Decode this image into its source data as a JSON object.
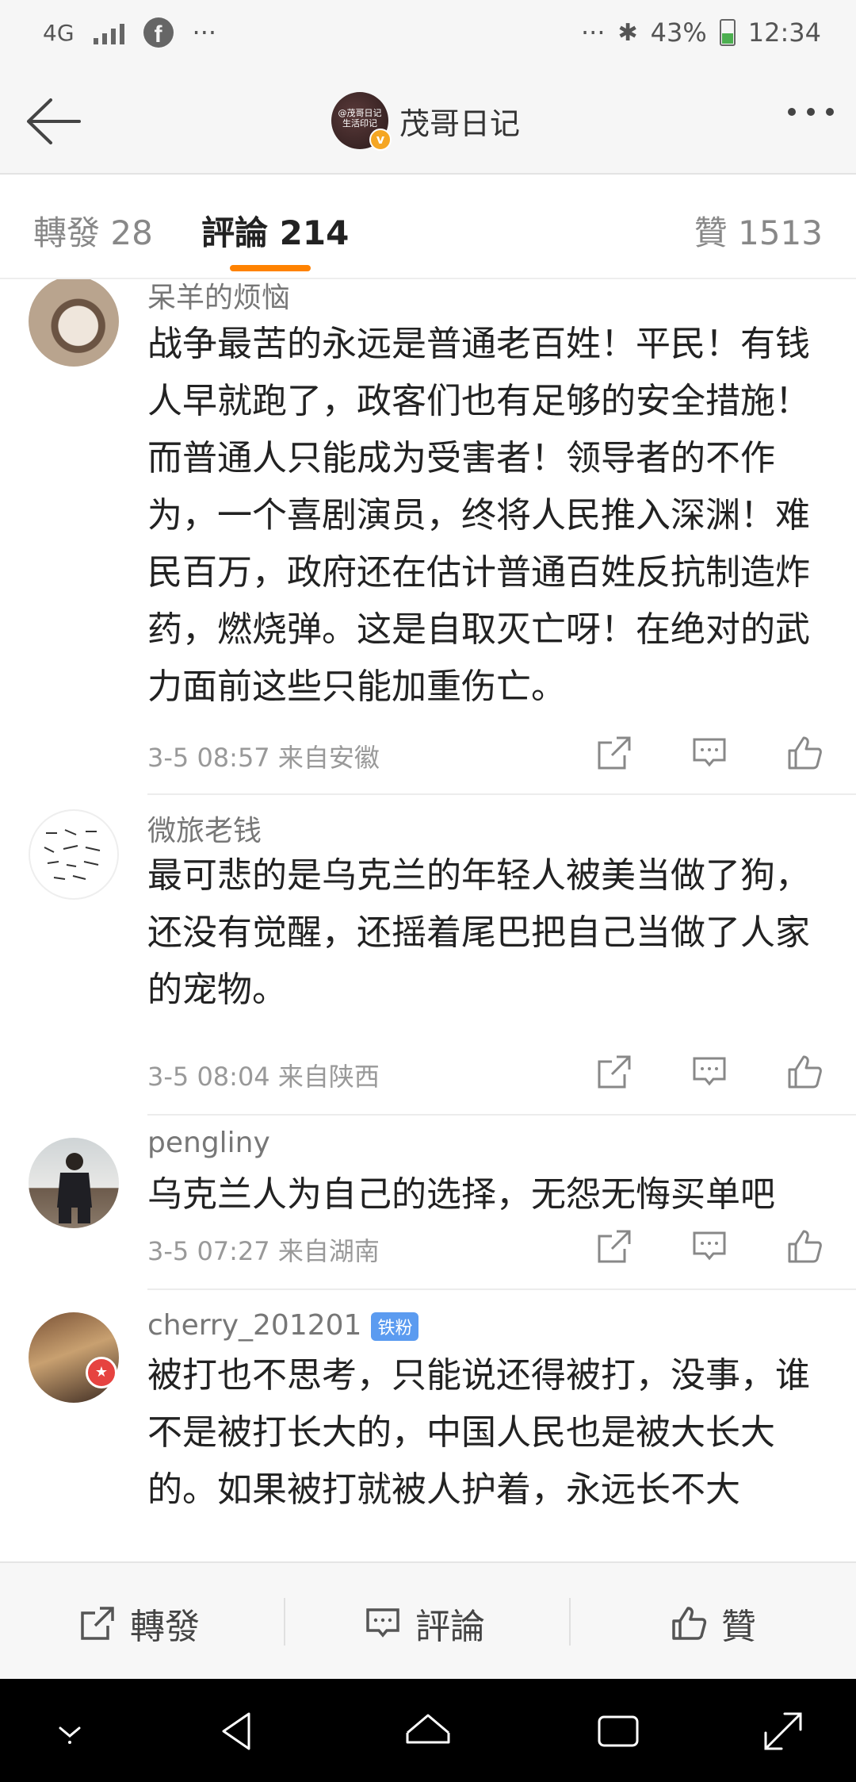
{
  "status_bar": {
    "network": "4G",
    "more": "···",
    "right_more": "···",
    "battery": "43%",
    "time": "12:34"
  },
  "header": {
    "account_name": "茂哥日记",
    "avatar_text": "@茂哥日记 生活印记"
  },
  "tabs": [
    {
      "label": "轉發 28"
    },
    {
      "label": "評論 214"
    },
    {
      "label": "贊 1513"
    }
  ],
  "comments": [
    {
      "username": "呆羊的烦恼",
      "lines": [
        "战争最苦的永远是普通老百姓！平民！有钱",
        "人早就跑了，政客们也有足够的安全措施！",
        "而普通人只能成为受害者！领导者的不作",
        "为，一个喜剧演员，终将人民推入深渊！难",
        "民百万，政府还在估计普通百姓反抗制造炸",
        "药，燃烧弹。这是自取灭亡呀！在绝对的武",
        "力面前这些只能加重伤亡。"
      ],
      "meta": "3-5 08:57  来自安徽"
    },
    {
      "username": "微旅老钱",
      "lines": [
        "最可悲的是乌克兰的年轻人被美当做了狗，",
        "还没有觉醒，还摇着尾巴把自己当做了人家",
        "的宠物。"
      ],
      "meta": "3-5 08:04  来自陕西"
    },
    {
      "username": "pengliny",
      "lines": [
        "乌克兰人为自己的选择，无怨无悔买单吧"
      ],
      "meta": "3-5 07:27  来自湖南"
    },
    {
      "username": "cherry_201201",
      "badge": "铁粉",
      "lines": [
        "被打也不思考，只能说还得被打，没事，谁",
        "不是被打长大的，中国人民也是被大长大",
        "的。如果被打就被人护着，永远长不大"
      ],
      "meta": ""
    }
  ],
  "bottom_bar": {
    "repost": "轉發",
    "comment": "評論",
    "like": "贊"
  },
  "colors": {
    "accent": "#ff8200",
    "fan_badge": "#5b9bf0"
  }
}
